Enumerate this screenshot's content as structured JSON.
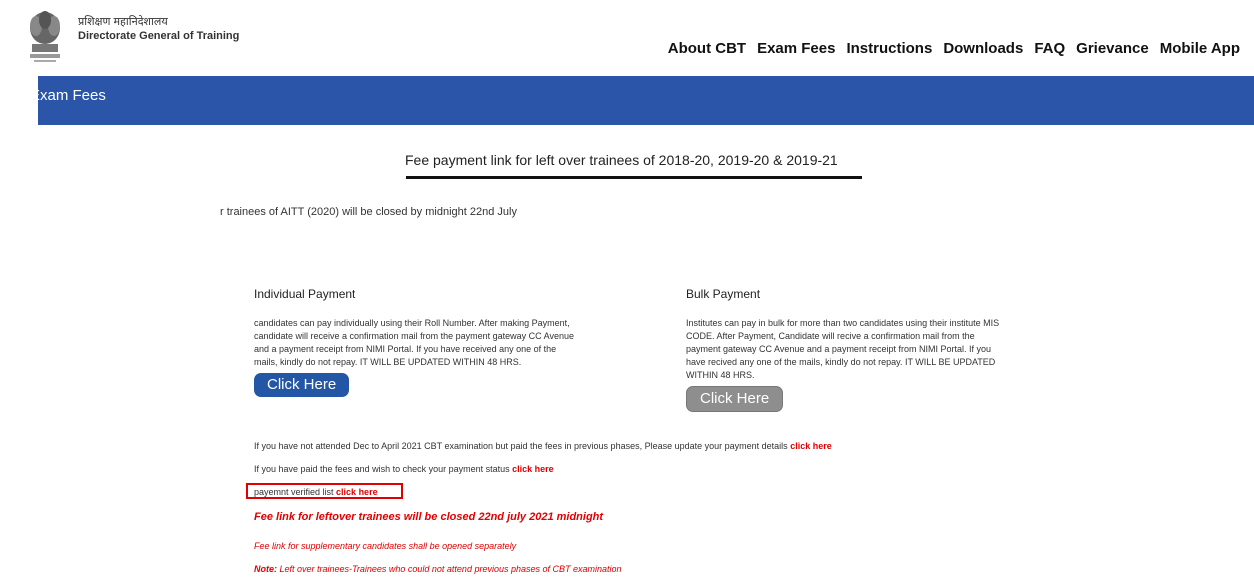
{
  "header": {
    "org_name_hindi": "प्रशिक्षण महानिदेशालय",
    "org_name_english": "Directorate General of Training",
    "nav": [
      "About CBT",
      "Exam Fees",
      "Instructions",
      "Downloads",
      "FAQ",
      "Grievance",
      "Mobile App"
    ]
  },
  "banner": {
    "title": "Exam Fees"
  },
  "main": {
    "heading": "Fee payment link for left over trainees of 2018-20, 2019-20 & 2019-21",
    "marquee": "r trainees of AITT (2020) will be closed by midnight 22nd July",
    "individual": {
      "title": "Individual Payment",
      "text": "candidates can pay individually using their Roll Number. After making Payment, candidate will receive a confirmation mail from the payment gateway CC Avenue and a payment receipt from NIMI Portal. If you have received any one of the mails, kindly do not repay. IT WILL BE UPDATED WITHIN 48 HRS.",
      "button": "Click Here"
    },
    "bulk": {
      "title": "Bulk Payment",
      "text": "Institutes can pay in bulk for more than two candidates using their institute MIS CODE. After Payment, Candidate will recive a confirmation mail from the payment gateway CC Avenue and a payment receipt from NIMI Portal. If you have recived any one of the mails, kindly do not repay. IT WILL BE UPDATED WITHIN 48 HRS.",
      "button": "Click Here"
    },
    "update_line": {
      "text": "If you have not attended Dec to April 2021 CBT examination but paid the fees in previous phases, Please update your payment details ",
      "link": "click here"
    },
    "status_line": {
      "text": "If you have paid the fees and wish to check your payment status ",
      "link": "click here"
    },
    "verified_line": {
      "text": "payemnt verified list ",
      "link": "click here"
    },
    "close_notice": "Fee link for leftover trainees will be closed 22nd july 2021 midnight",
    "supplementary": "Fee link for supplementary candidates shall be opened separately",
    "note_label": "Note:",
    "note_text": " Left over trainees-Trainees who could not attend previous phases of CBT examination"
  },
  "colors": {
    "banner": "#2a55a8",
    "button_blue": "#2456a6",
    "button_grey": "#8e8e8e",
    "link_red": "#e00000"
  }
}
